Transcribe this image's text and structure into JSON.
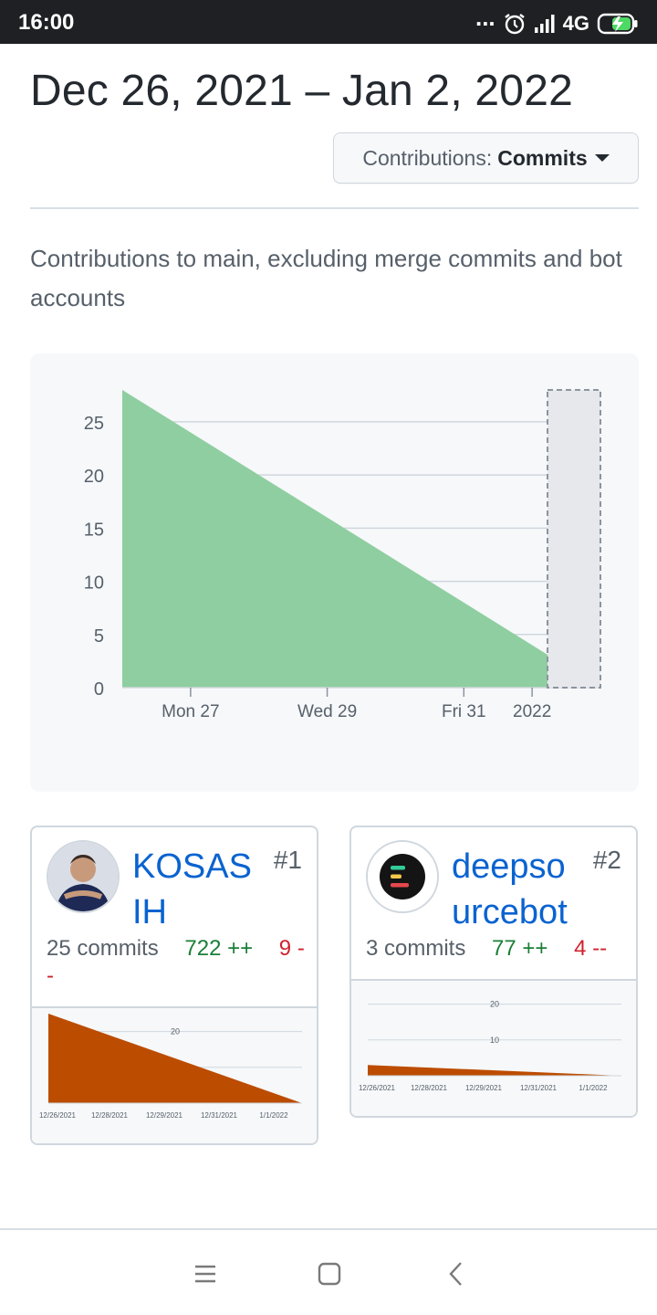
{
  "status_bar": {
    "time": "16:00",
    "dots": "...",
    "network": "4G",
    "icons": [
      "alarm-icon",
      "signal-icon",
      "battery-charging-icon"
    ]
  },
  "header": {
    "date_range": "Dec 26, 2021 – Jan 2, 2022"
  },
  "filter": {
    "label": "Contributions:",
    "value": "Commits"
  },
  "description": "Contributions to main, excluding merge commits and bot accounts",
  "colors": {
    "area_green": "#8fcea0",
    "contributor_area": "#bc4c00",
    "link_blue": "#0a63d0",
    "additions": "#1a7f37",
    "deletions": "#cf222e"
  },
  "chart_data": [
    {
      "type": "area",
      "x": [
        "12/26/2021",
        "1/2/2022"
      ],
      "y": [
        28,
        0
      ],
      "x_ticks": [
        "Mon 27",
        "Wed 29",
        "Fri 31",
        "2022"
      ],
      "y_ticks": [
        "0",
        "5",
        "10",
        "15",
        "20",
        "25"
      ],
      "ylim": [
        0,
        28
      ],
      "grid": true
    },
    {
      "type": "area",
      "x": [
        "12/26/2021",
        "1/2/2022"
      ],
      "y": [
        25,
        0
      ],
      "x_ticks": [
        "12/26/2021",
        "12/28/2021",
        "12/29/2021",
        "12/31/2021",
        "1/1/2022"
      ],
      "y_ticks": [
        "20"
      ],
      "ylim": [
        0,
        25
      ],
      "grid": true
    },
    {
      "type": "area",
      "x": [
        "12/26/2021",
        "1/2/2022"
      ],
      "y": [
        3,
        0
      ],
      "x_ticks": [
        "12/26/2021",
        "12/28/2021",
        "12/29/2021",
        "12/31/2021",
        "1/1/2022"
      ],
      "y_ticks": [
        "10",
        "20"
      ],
      "ylim": [
        0,
        25
      ],
      "grid": true
    }
  ],
  "contributors": [
    {
      "rank": "#1",
      "name": "KOSASIH",
      "commits": "25 commits",
      "additions": "722 ++",
      "deletions": "9 --"
    },
    {
      "rank": "#2",
      "name": "deepsourcebot",
      "commits": "3 commits",
      "additions": "77 ++",
      "deletions": "4 --"
    }
  ],
  "nav_bar": {
    "buttons": [
      "menu-icon",
      "home-icon",
      "back-icon"
    ]
  }
}
